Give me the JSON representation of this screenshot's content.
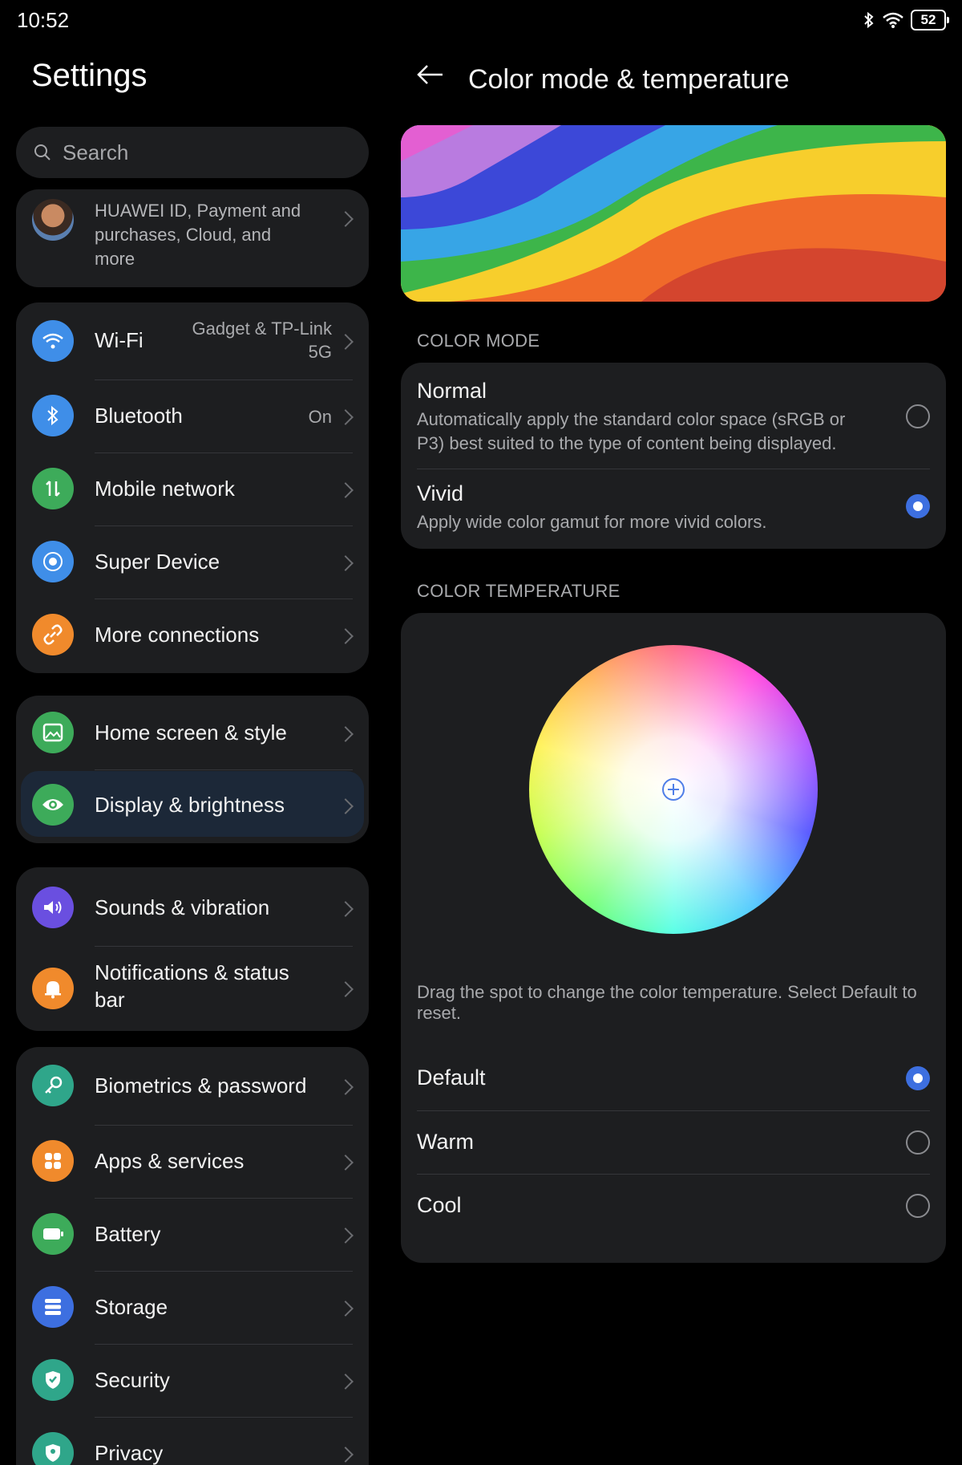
{
  "status": {
    "time": "10:52",
    "battery": "52"
  },
  "left": {
    "title": "Settings",
    "search_placeholder": "Search",
    "account": {
      "desc": "HUAWEI ID, Payment and purchases, Cloud, and more"
    },
    "groups": [
      [
        {
          "label": "Wi-Fi",
          "value": "Gadget & TP-Link 5G",
          "icon": "wifi-icon",
          "color": "#3f8ee8"
        },
        {
          "label": "Bluetooth",
          "value": "On",
          "icon": "bluetooth-icon",
          "color": "#3f8ee8"
        },
        {
          "label": "Mobile network",
          "value": "",
          "icon": "mobile-data-icon",
          "color": "#3dab5a"
        },
        {
          "label": "Super Device",
          "value": "",
          "icon": "super-device-icon",
          "color": "#3f8ee8"
        },
        {
          "label": "More connections",
          "value": "",
          "icon": "link-icon",
          "color": "#f08a2c"
        }
      ],
      [
        {
          "label": "Home screen & style",
          "icon": "image-icon",
          "color": "#3dab5a"
        },
        {
          "label": "Display & brightness",
          "icon": "eye-icon",
          "color": "#3dab5a",
          "selected": true
        }
      ],
      [
        {
          "label": "Sounds & vibration",
          "icon": "speaker-icon",
          "color": "#6a4fe0"
        },
        {
          "label": "Notifications & status bar",
          "icon": "bell-icon",
          "color": "#f08a2c"
        }
      ],
      [
        {
          "label": "Biometrics & password",
          "icon": "key-icon",
          "color": "#2fa68a"
        },
        {
          "label": "Apps & services",
          "icon": "apps-icon",
          "color": "#f08a2c"
        },
        {
          "label": "Battery",
          "icon": "battery-icon",
          "color": "#3dab5a"
        },
        {
          "label": "Storage",
          "icon": "storage-icon",
          "color": "#3d6fe0"
        },
        {
          "label": "Security",
          "icon": "shield-icon",
          "color": "#2fa68a"
        },
        {
          "label": "Privacy",
          "icon": "privacy-icon",
          "color": "#2fa68a"
        }
      ]
    ]
  },
  "right": {
    "title": "Color mode & temperature",
    "color_mode_header": "COLOR MODE",
    "modes": [
      {
        "title": "Normal",
        "desc": "Automatically apply the standard color space (sRGB or P3) best suited to the type of content being displayed.",
        "selected": false
      },
      {
        "title": "Vivid",
        "desc": "Apply wide color gamut for more vivid colors.",
        "selected": true
      }
    ],
    "color_temp_header": "COLOR TEMPERATURE",
    "hint": "Drag the spot to change the color temperature. Select Default to reset.",
    "temps": [
      {
        "label": "Default",
        "selected": true
      },
      {
        "label": "Warm",
        "selected": false
      },
      {
        "label": "Cool",
        "selected": false
      }
    ]
  }
}
